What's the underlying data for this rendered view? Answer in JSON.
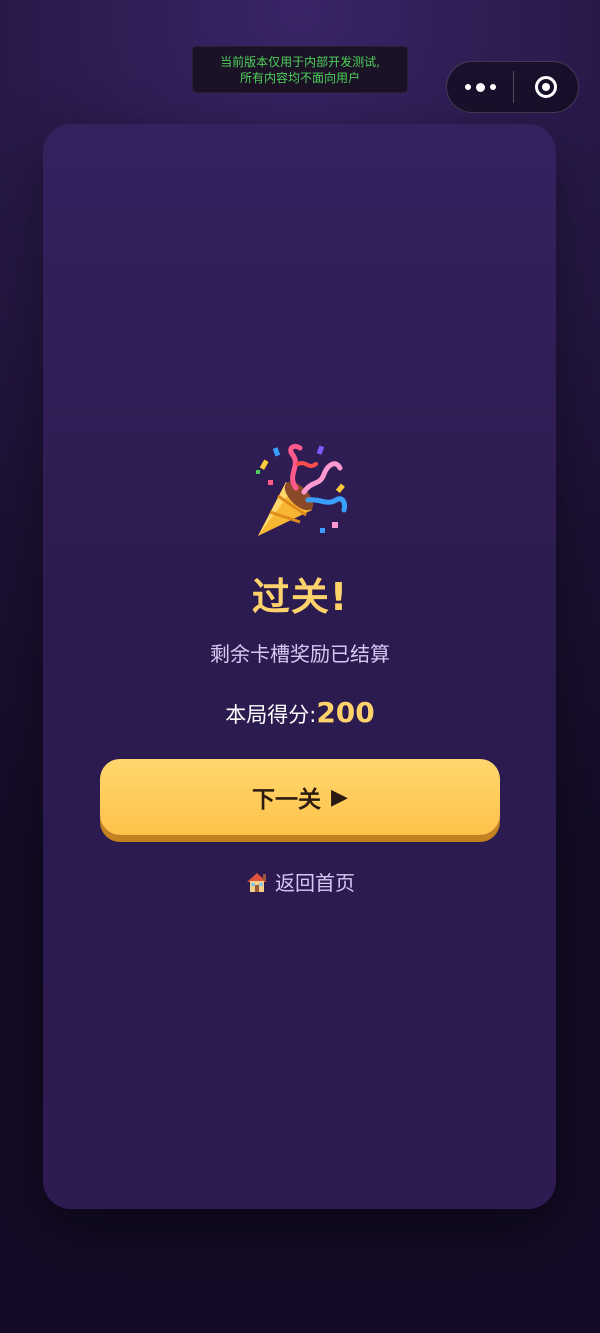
{
  "dev_banner": {
    "line1": "当前版本仅用于内部开发测试,",
    "line2": "所有内容均不面向用户"
  },
  "capsule": {
    "more_icon": "more-dots-icon",
    "close_icon": "target-close-icon"
  },
  "result": {
    "icon": "party-popper-icon",
    "title": "过关!",
    "subtitle": "剩余卡槽奖励已结算",
    "score_label": "本局得分:",
    "score_value": "200"
  },
  "actions": {
    "next_label": "下一关",
    "next_arrow": "▶",
    "home_icon": "house-icon",
    "home_label": "返回首页"
  },
  "colors": {
    "accent_gold": "#ffd36b",
    "button_gold": "#ffc24a",
    "card_purple": "#2c1b4f",
    "banner_green": "#4dd05a"
  }
}
